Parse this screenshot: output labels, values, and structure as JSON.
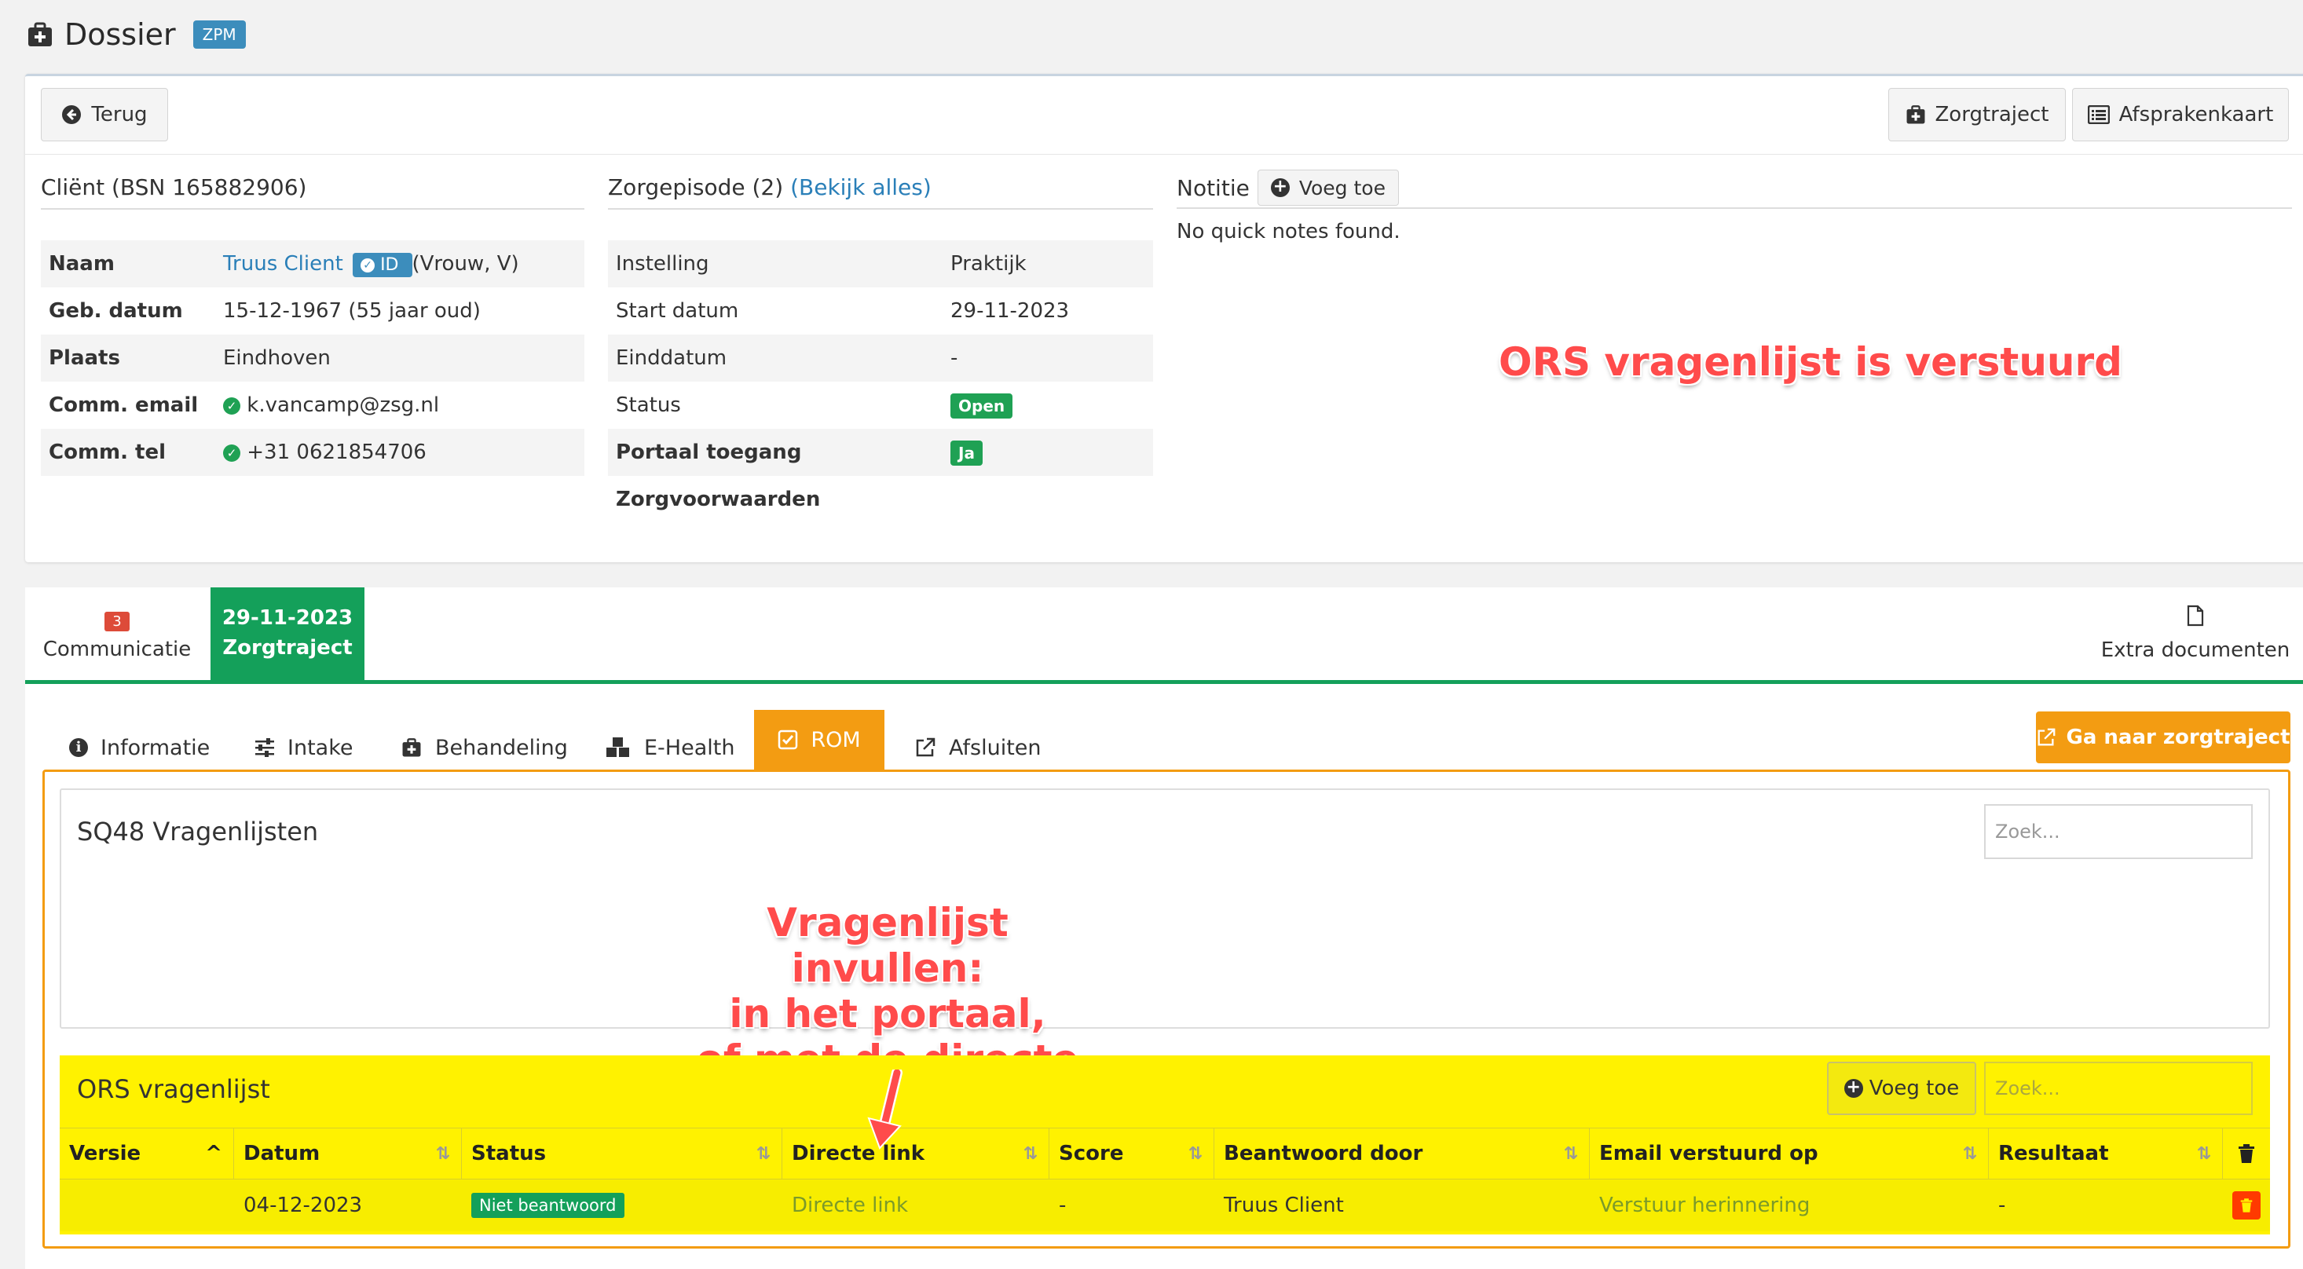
{
  "header": {
    "title": "Dossier",
    "badge": "ZPM"
  },
  "toolbar": {
    "back_label": "Terug",
    "zorgtraject_label": "Zorgtraject",
    "afsprakenkaart_label": "Afsprakenkaart"
  },
  "client": {
    "heading": "Cliënt (BSN 165882906)",
    "rows": {
      "naam_key": "Naam",
      "naam_value": "Truus Client",
      "naam_id": "ID",
      "naam_extra": "(Vrouw, V)",
      "geb_key": "Geb. datum",
      "geb_value": "15-12-1967 (55 jaar oud)",
      "plaats_key": "Plaats",
      "plaats_value": "Eindhoven",
      "email_key": "Comm. email",
      "email_value": "k.vancamp@zsg.nl",
      "tel_key": "Comm. tel",
      "tel_value": "+31 0621854706"
    }
  },
  "episode": {
    "heading": "Zorgepisode (2)",
    "link": "(Bekijk alles)",
    "rows": {
      "instelling_key": "Instelling",
      "instelling_value": "Praktijk",
      "start_key": "Start datum",
      "start_value": "29-11-2023",
      "eind_key": "Einddatum",
      "eind_value": "-",
      "status_key": "Status",
      "status_value": "Open",
      "portaal_key": "Portaal toegang",
      "portaal_value": "Ja",
      "voorwaarden_key": "Zorgvoorwaarden"
    }
  },
  "notitie": {
    "heading": "Notitie",
    "add_label": "Voeg toe",
    "empty": "No quick notes found."
  },
  "annotations": {
    "ors_sent": "ORS vragenlijst is verstuurd",
    "fill_line1": "Vragenlijst invullen:",
    "fill_line2": "in het portaal,",
    "fill_line3": "of met de directe link"
  },
  "tabs": {
    "comm_count": "3",
    "comm_label": "Communicatie",
    "zorg_date": "29-11-2023",
    "zorg_label": "Zorgtraject",
    "extra_label": "Extra documenten"
  },
  "subtabs": {
    "informatie": "Informatie",
    "intake": "Intake",
    "behandeling": "Behandeling",
    "ehealth": "E-Health",
    "rom": "ROM",
    "afsluiten": "Afsluiten",
    "ga_naar": "Ga naar zorgtraject"
  },
  "sq48": {
    "title": "SQ48 Vragenlijsten",
    "search_placeholder": "Zoek..."
  },
  "ors": {
    "title": "ORS vragenlijst",
    "add_label": "Voeg toe",
    "search_placeholder": "Zoek...",
    "columns": [
      "Versie",
      "Datum",
      "Status",
      "Directe link",
      "Score",
      "Beantwoord door",
      "Email verstuurd op",
      "Resultaat"
    ],
    "row": {
      "versie": "",
      "datum": "04-12-2023",
      "status": "Niet beantwoord",
      "link": "Directe link",
      "score": "-",
      "door": "Truus Client",
      "email": "Verstuur herinnering",
      "resultaat": "-"
    }
  },
  "colors": {
    "accent_green": "#14a05a",
    "accent_orange": "#f39c12",
    "highlight_yellow": "#fff200",
    "link_blue": "#2a7fb8",
    "annotation_red": "#ff4b4b"
  }
}
